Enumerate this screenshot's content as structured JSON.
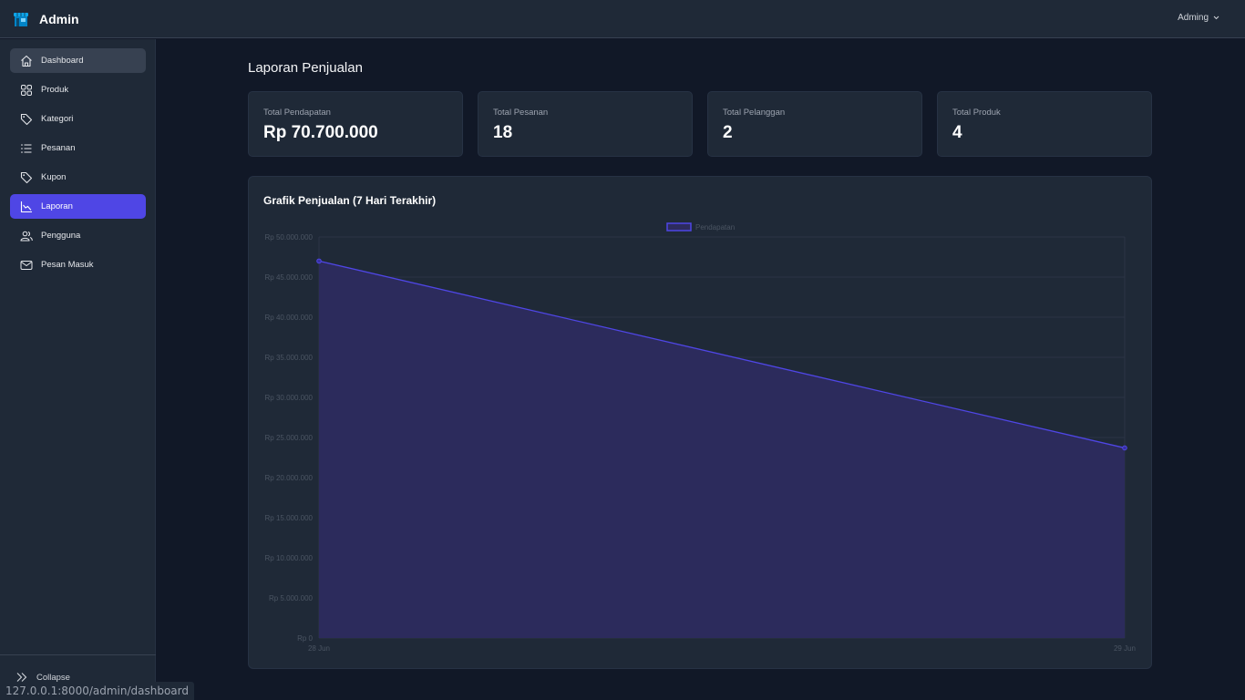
{
  "app": {
    "brand": "Admin",
    "user": "Adming"
  },
  "sidebar": {
    "items": [
      {
        "label": "Dashboard",
        "icon": "home-icon",
        "state": "hover"
      },
      {
        "label": "Produk",
        "icon": "grid-icon",
        "state": ""
      },
      {
        "label": "Kategori",
        "icon": "tag-icon",
        "state": ""
      },
      {
        "label": "Pesanan",
        "icon": "list-icon",
        "state": ""
      },
      {
        "label": "Kupon",
        "icon": "tag-icon",
        "state": ""
      },
      {
        "label": "Laporan",
        "icon": "chart-icon",
        "state": "active"
      },
      {
        "label": "Pengguna",
        "icon": "users-icon",
        "state": ""
      },
      {
        "label": "Pesan Masuk",
        "icon": "mail-icon",
        "state": ""
      }
    ],
    "collapse_label": "Collapse"
  },
  "page": {
    "title": "Laporan Penjualan"
  },
  "stats": [
    {
      "label": "Total Pendapatan",
      "value": "Rp 70.700.000"
    },
    {
      "label": "Total Pesanan",
      "value": "18"
    },
    {
      "label": "Total Pelanggan",
      "value": "2"
    },
    {
      "label": "Total Produk",
      "value": "4"
    }
  ],
  "chart": {
    "title": "Grafik Penjualan (7 Hari Terakhir)"
  },
  "chart_data": {
    "type": "area",
    "x": [
      "28 Jun",
      "29 Jun"
    ],
    "series": [
      {
        "name": "Pendapatan",
        "values": [
          47000000,
          23700000
        ]
      }
    ],
    "ylim": [
      0,
      50000000
    ],
    "yticks": [
      "Rp 0",
      "Rp 5.000.000",
      "Rp 10.000.000",
      "Rp 15.000.000",
      "Rp 20.000.000",
      "Rp 25.000.000",
      "Rp 30.000.000",
      "Rp 35.000.000",
      "Rp 40.000.000",
      "Rp 45.000.000",
      "Rp 50.000.000"
    ],
    "legend": "top-center",
    "grid": true,
    "colors": {
      "line": "#4f46e5",
      "fill": "#2d2b5e"
    }
  },
  "status_bar": {
    "url": "127.0.0.1:8000/admin/dashboard"
  }
}
